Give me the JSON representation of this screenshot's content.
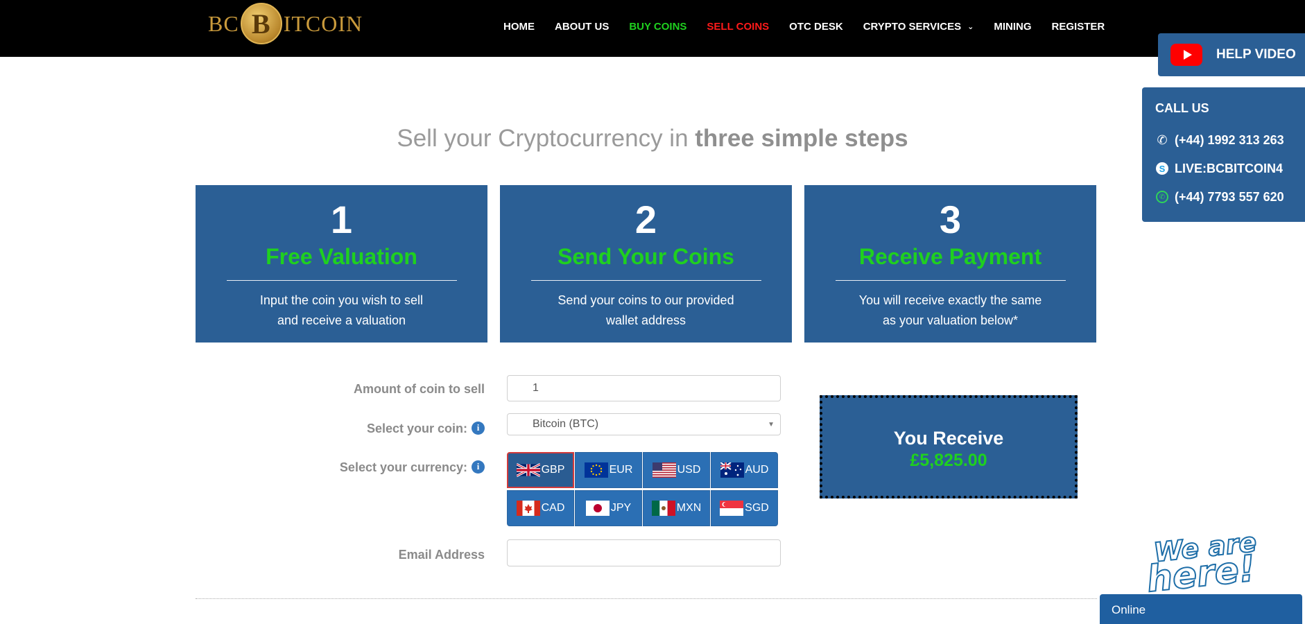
{
  "header": {
    "logo_prefix": "BC",
    "logo_coin": "B",
    "logo_suffix": "ITCOIN",
    "nav": [
      {
        "label": "HOME"
      },
      {
        "label": "ABOUT US"
      },
      {
        "label": "BUY COINS",
        "color": "#1fd01f"
      },
      {
        "label": "SELL COINS",
        "color": "#ff1a1a"
      },
      {
        "label": "OTC DESK"
      },
      {
        "label": "CRYPTO SERVICES",
        "icon": "chevron-down-icon"
      },
      {
        "label": "MINING"
      },
      {
        "label": "REGISTER"
      }
    ]
  },
  "side": {
    "help_video": "HELP VIDEO",
    "call_us": {
      "title": "CALL US",
      "phone": "(+44) 1992 313 263",
      "skype": "LIVE:BCBITCOIN4",
      "whatsapp": "(+44) 7793 557 620"
    }
  },
  "hero": {
    "title_plain": "Sell your Cryptocurrency in ",
    "title_bold": "three simple steps"
  },
  "steps": [
    {
      "number": "1",
      "title": "Free Valuation",
      "line1": "Input the coin you wish to sell",
      "line2": "and receive a valuation"
    },
    {
      "number": "2",
      "title": "Send Your Coins",
      "line1": "Send your coins to our provided",
      "line2": "wallet address"
    },
    {
      "number": "3",
      "title": "Receive Payment",
      "line1": "You will receive exactly the same",
      "line2": "as your valuation below*"
    }
  ],
  "form": {
    "amount_label": "Amount of coin to sell",
    "amount_value": "1",
    "coin_label": "Select your coin:",
    "coin_value": "Bitcoin (BTC)",
    "currency_label": "Select your currency:",
    "email_label": "Email Address",
    "email_value": "",
    "currencies": [
      {
        "code": "GBP",
        "flag": "uk-flag-icon",
        "selected": true
      },
      {
        "code": "EUR",
        "flag": "eu-flag-icon"
      },
      {
        "code": "USD",
        "flag": "us-flag-icon"
      },
      {
        "code": "AUD",
        "flag": "au-flag-icon"
      },
      {
        "code": "CAD",
        "flag": "ca-flag-icon"
      },
      {
        "code": "JPY",
        "flag": "jp-flag-icon"
      },
      {
        "code": "MXN",
        "flag": "mx-flag-icon"
      },
      {
        "code": "SGD",
        "flag": "sg-flag-icon"
      }
    ]
  },
  "receive": {
    "title": "You Receive",
    "value": "£5,825.00"
  },
  "chat": {
    "badge_line1": "We are",
    "badge_line2": "here!",
    "status": "Online"
  },
  "colors": {
    "brand_blue": "#2b5f95",
    "accent_green": "#1fd01f",
    "sell_red": "#ff1a1a"
  }
}
